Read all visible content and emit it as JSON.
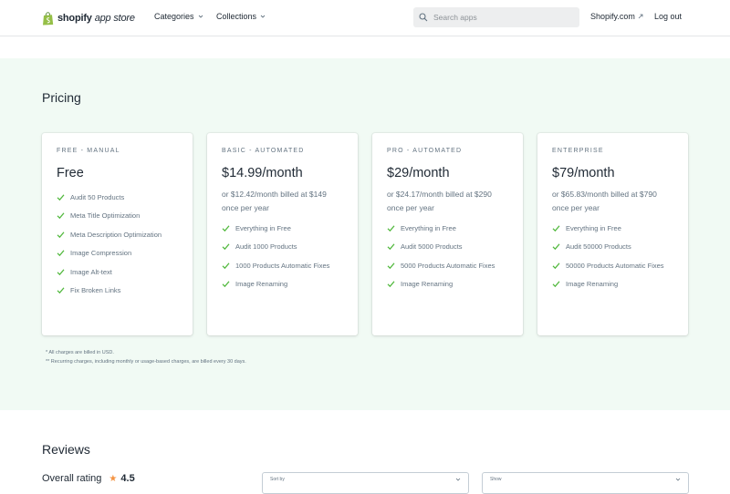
{
  "header": {
    "logo_brand": "shopify",
    "logo_suffix": "app store",
    "nav": [
      {
        "label": "Categories",
        "icon": "chevron-down-icon"
      },
      {
        "label": "Collections",
        "icon": "chevron-down-icon"
      }
    ],
    "search_placeholder": "Search apps",
    "shopify_link": "Shopify.com",
    "logout": "Log out"
  },
  "pricing": {
    "title": "Pricing",
    "plans": [
      {
        "name": "FREE - MANUAL",
        "price": "Free",
        "alt": "",
        "features": [
          "Audit 50 Products",
          "Meta Title Optimization",
          "Meta Description Optimization",
          "Image Compression",
          "Image Alt-text",
          "Fix Broken Links"
        ]
      },
      {
        "name": "BASIC - AUTOMATED",
        "price": "$14.99/month",
        "alt": "or $12.42/month billed at $149 once per year",
        "features": [
          "Everything in Free",
          "Audit 1000 Products",
          "1000 Products Automatic Fixes",
          "Image Renaming"
        ]
      },
      {
        "name": "PRO - AUTOMATED",
        "price": "$29/month",
        "alt": "or $24.17/month billed at $290 once per year",
        "features": [
          "Everything in Free",
          "Audit 5000 Products",
          "5000 Products Automatic Fixes",
          "Image Renaming"
        ]
      },
      {
        "name": "ENTERPRISE",
        "price": "$79/month",
        "alt": "or $65.83/month billed at $790 once per year",
        "features": [
          "Everything in Free",
          "Audit 50000 Products",
          "50000 Products Automatic Fixes",
          "Image Renaming"
        ]
      }
    ],
    "footnotes": [
      "* All charges are billed in USD.",
      "** Recurring charges, including monthly or usage-based charges, are billed every 30 days."
    ]
  },
  "reviews": {
    "title": "Reviews",
    "overall_label": "Overall rating",
    "overall_value": "4.5",
    "sort_label": "Sort by",
    "show_label": "Show"
  },
  "colors": {
    "brand_green": "#95bf47",
    "check_green": "#50b83c",
    "pricing_bg": "#f1faf4",
    "star": "#f49342"
  }
}
